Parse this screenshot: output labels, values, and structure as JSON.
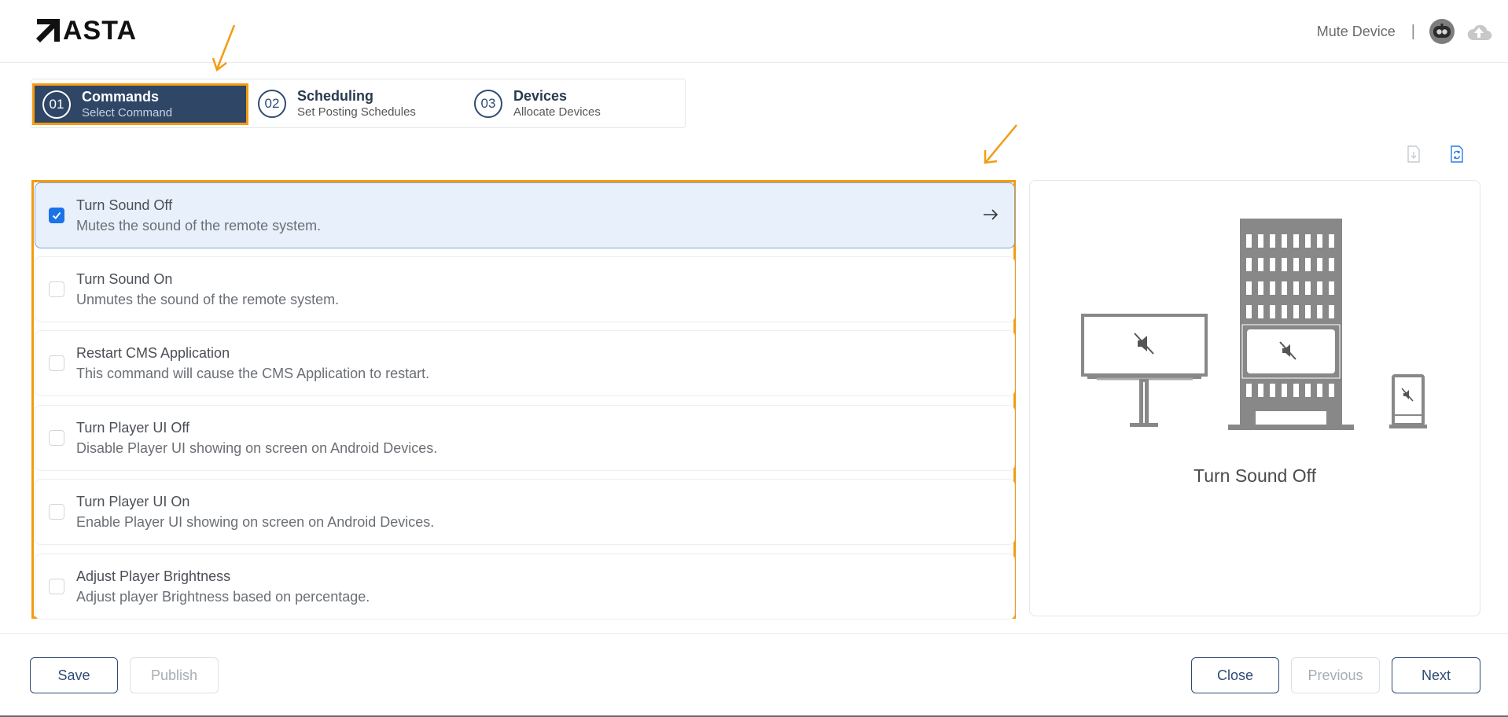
{
  "app": {
    "brand": "ASTA",
    "header_title": "Mute Device",
    "header_separator": "|"
  },
  "icons": {
    "logo": "asta-arrow-logo",
    "avatar": "robot-avatar-icon",
    "cloud": "cloud-upload-icon",
    "download": "download-file-icon",
    "refresh": "refresh-icon",
    "checkbox_checked": "check-icon",
    "row_arrow": "arrow-right-icon"
  },
  "colors": {
    "primary": "#2f4666",
    "accent_annotation": "#f39c12",
    "checkbox": "#1a73e8",
    "selected_row_bg": "#e8f1fb"
  },
  "steps": [
    {
      "number": "01",
      "title": "Commands",
      "subtitle": "Select Command",
      "active": true
    },
    {
      "number": "02",
      "title": "Scheduling",
      "subtitle": "Set Posting Schedules",
      "active": false
    },
    {
      "number": "03",
      "title": "Devices",
      "subtitle": "Allocate Devices",
      "active": false
    }
  ],
  "commands": [
    {
      "title": "Turn Sound Off",
      "description": "Mutes the sound of the remote system.",
      "checked": true
    },
    {
      "title": "Turn Sound On",
      "description": "Unmutes the sound of the remote system.",
      "checked": false
    },
    {
      "title": "Restart CMS Application",
      "description": "This command will cause the CMS Application to restart.",
      "checked": false
    },
    {
      "title": "Turn Player UI Off",
      "description": "Disable Player UI showing on screen on Android Devices.",
      "checked": false
    },
    {
      "title": "Turn Player UI On",
      "description": "Enable Player UI showing on screen on Android Devices.",
      "checked": false
    },
    {
      "title": "Adjust Player Brightness",
      "description": "Adjust player Brightness based on percentage.",
      "checked": false
    }
  ],
  "preview": {
    "label": "Turn Sound Off"
  },
  "footer": {
    "save": "Save",
    "publish": "Publish",
    "close": "Close",
    "previous": "Previous",
    "next": "Next"
  }
}
